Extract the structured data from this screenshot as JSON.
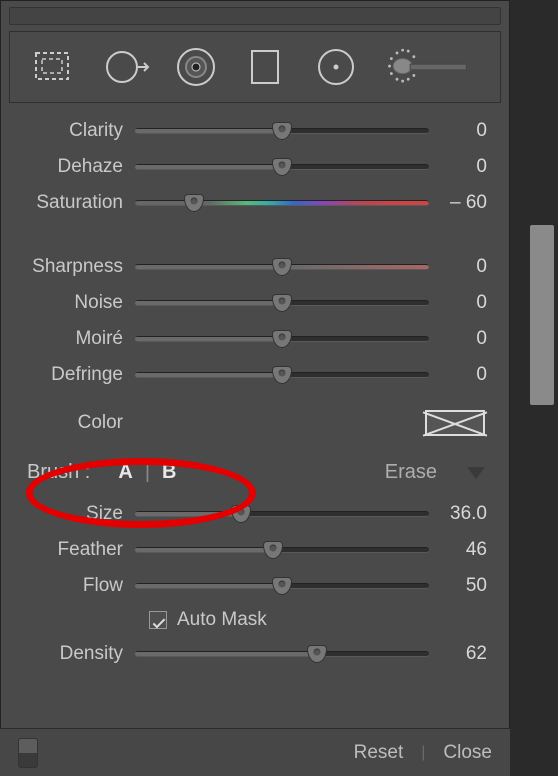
{
  "sliders": {
    "clarity": {
      "label": "Clarity",
      "value": "0",
      "pos": 50
    },
    "dehaze": {
      "label": "Dehaze",
      "value": "0",
      "pos": 50
    },
    "saturation": {
      "label": "Saturation",
      "value": "– 60",
      "pos": 20
    },
    "sharpness": {
      "label": "Sharpness",
      "value": "0",
      "pos": 50
    },
    "noise": {
      "label": "Noise",
      "value": "0",
      "pos": 50
    },
    "moire": {
      "label": "Moiré",
      "value": "0",
      "pos": 50
    },
    "defringe": {
      "label": "Defringe",
      "value": "0",
      "pos": 50
    },
    "size": {
      "label": "Size",
      "value": "36.0",
      "pos": 36
    },
    "feather": {
      "label": "Feather",
      "value": "46",
      "pos": 47
    },
    "flow": {
      "label": "Flow",
      "value": "50",
      "pos": 50
    },
    "density": {
      "label": "Density",
      "value": "62",
      "pos": 62
    }
  },
  "color": {
    "label": "Color"
  },
  "brush": {
    "label": "Brush :",
    "a": "A",
    "b": "B",
    "erase": "Erase"
  },
  "automask": {
    "label": "Auto Mask"
  },
  "footer": {
    "reset": "Reset",
    "close": "Close"
  }
}
